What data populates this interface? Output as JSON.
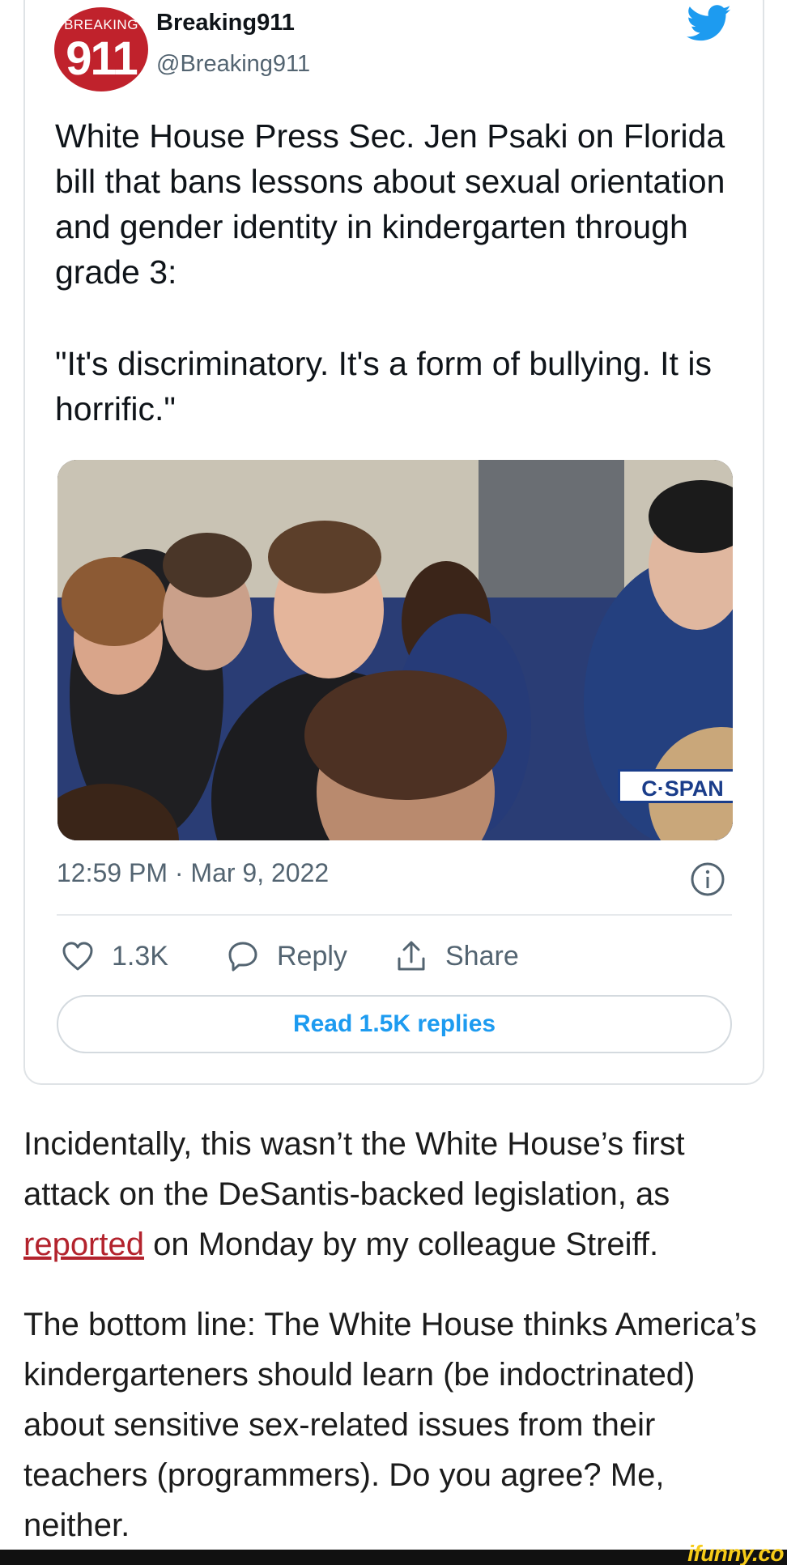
{
  "tweet": {
    "avatar_top_text": "BREAKING",
    "avatar_number": "911",
    "display_name": "Breaking911",
    "handle": "@Breaking911",
    "paragraphs": [
      "White House Press Sec. Jen Psaki on Florida bill that bans lessons about sexual orientation and gender identity in kindergarten through grade 3:",
      "\"It's discriminatory. It's a form of bullying. It is horrific.\""
    ],
    "media_watermark": "C·SPAN",
    "timestamp": "12:59 PM · Mar 9, 2022",
    "actions": {
      "like_count": "1.3K",
      "reply_label": "Reply",
      "share_label": "Share"
    },
    "read_replies_label": "Read 1.5K replies"
  },
  "article": {
    "p1_before": "Incidentally, this wasn’t the White House’s first attack on the DeSantis-backed legislation, as ",
    "p1_link": "reported",
    "p1_after": " on Monday by my colleague Streiff.",
    "p2": "The bottom line: The White House thinks America’s kindergarteners should learn (be indoctrinated) about sensitive sex-related issues from their teachers (programmers). Do you agree? Me, neither."
  },
  "watermark": "ifunny.co",
  "colors": {
    "twitter_blue": "#1d9bf0",
    "avatar_red": "#c0222c",
    "link_red": "#b3232d",
    "secondary_text": "#536471",
    "ifunny_yellow": "#f6cb18"
  },
  "icons": [
    "twitter-bird-icon",
    "info-icon",
    "heart-icon",
    "reply-bubble-icon",
    "share-icon"
  ]
}
